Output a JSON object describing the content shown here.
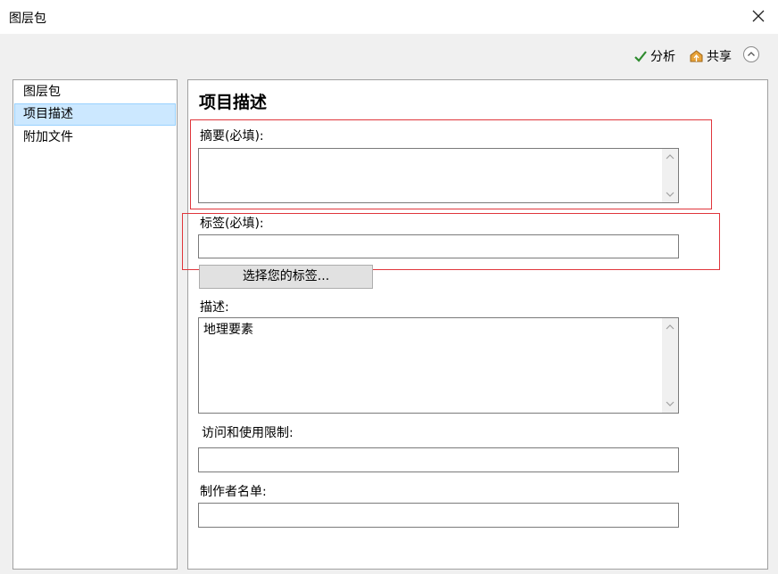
{
  "window": {
    "title": "图层包"
  },
  "toolbar": {
    "analyze_label": "分析",
    "share_label": "共享"
  },
  "nav": {
    "items": [
      {
        "label": "图层包",
        "selected": false
      },
      {
        "label": "项目描述",
        "selected": true
      },
      {
        "label": "附加文件",
        "selected": false
      }
    ]
  },
  "form": {
    "heading": "项目描述",
    "summary_label": "摘要(必填):",
    "summary_value": "",
    "tags_label": "标签(必填):",
    "tags_value": "",
    "choose_tags_button": "选择您的标签...",
    "description_label": "描述:",
    "description_value": "地理要素",
    "access_label": "访问和使用限制:",
    "access_value": "",
    "credits_label": "制作者名单:",
    "credits_value": ""
  },
  "colors": {
    "highlight": "#e0353b",
    "selection": "#cce8ff",
    "check": "#2e8b2e"
  }
}
